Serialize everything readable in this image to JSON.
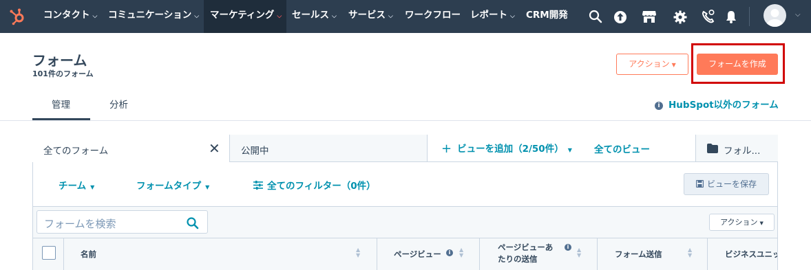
{
  "nav": {
    "items": [
      {
        "label": "コンタクト",
        "caret": "⌵"
      },
      {
        "label": "コミュニケーション",
        "caret": "⌵"
      },
      {
        "label": "マーケティング",
        "caret": "⌵"
      },
      {
        "label": "セールス",
        "caret": "⌵"
      },
      {
        "label": "サービス",
        "caret": "⌵"
      },
      {
        "label": "ワークフロー"
      },
      {
        "label": "レポート",
        "caret": "⌵"
      },
      {
        "label": "CRM開発"
      }
    ],
    "avatar_caret": "⌵"
  },
  "header": {
    "title": "フォーム",
    "subtitle": "101件のフォーム",
    "actions_label": "アクション",
    "create_label": "フォームを作成"
  },
  "tabs": {
    "manage": "管理",
    "analyze": "分析",
    "external_link": "HubSpot以外のフォーム"
  },
  "views": {
    "tab1": "全てのフォーム",
    "tab2": "公開中",
    "add_view": "ビューを追加（2/50件）",
    "all_views": "全てのビュー",
    "folders": "フォル..."
  },
  "filters": {
    "team": "チーム",
    "form_type": "フォームタイプ",
    "all_filters": "全てのフィルター（0件）",
    "save_view": "ビューを保存"
  },
  "search": {
    "placeholder": "フォームを検索",
    "actions_label": "アクション"
  },
  "table": {
    "columns": [
      "名前",
      "ページビュー",
      "ページビューあたりの送信",
      "フォーム送信",
      "ビジネスユニット"
    ],
    "col3_line1": "ページビューあ",
    "col3_line2": "たりの送信"
  },
  "colors": {
    "nav_bg": "#2d3e50",
    "accent_orange": "#ff7a59",
    "link_teal": "#0091ae",
    "highlight_red": "#d10000"
  }
}
